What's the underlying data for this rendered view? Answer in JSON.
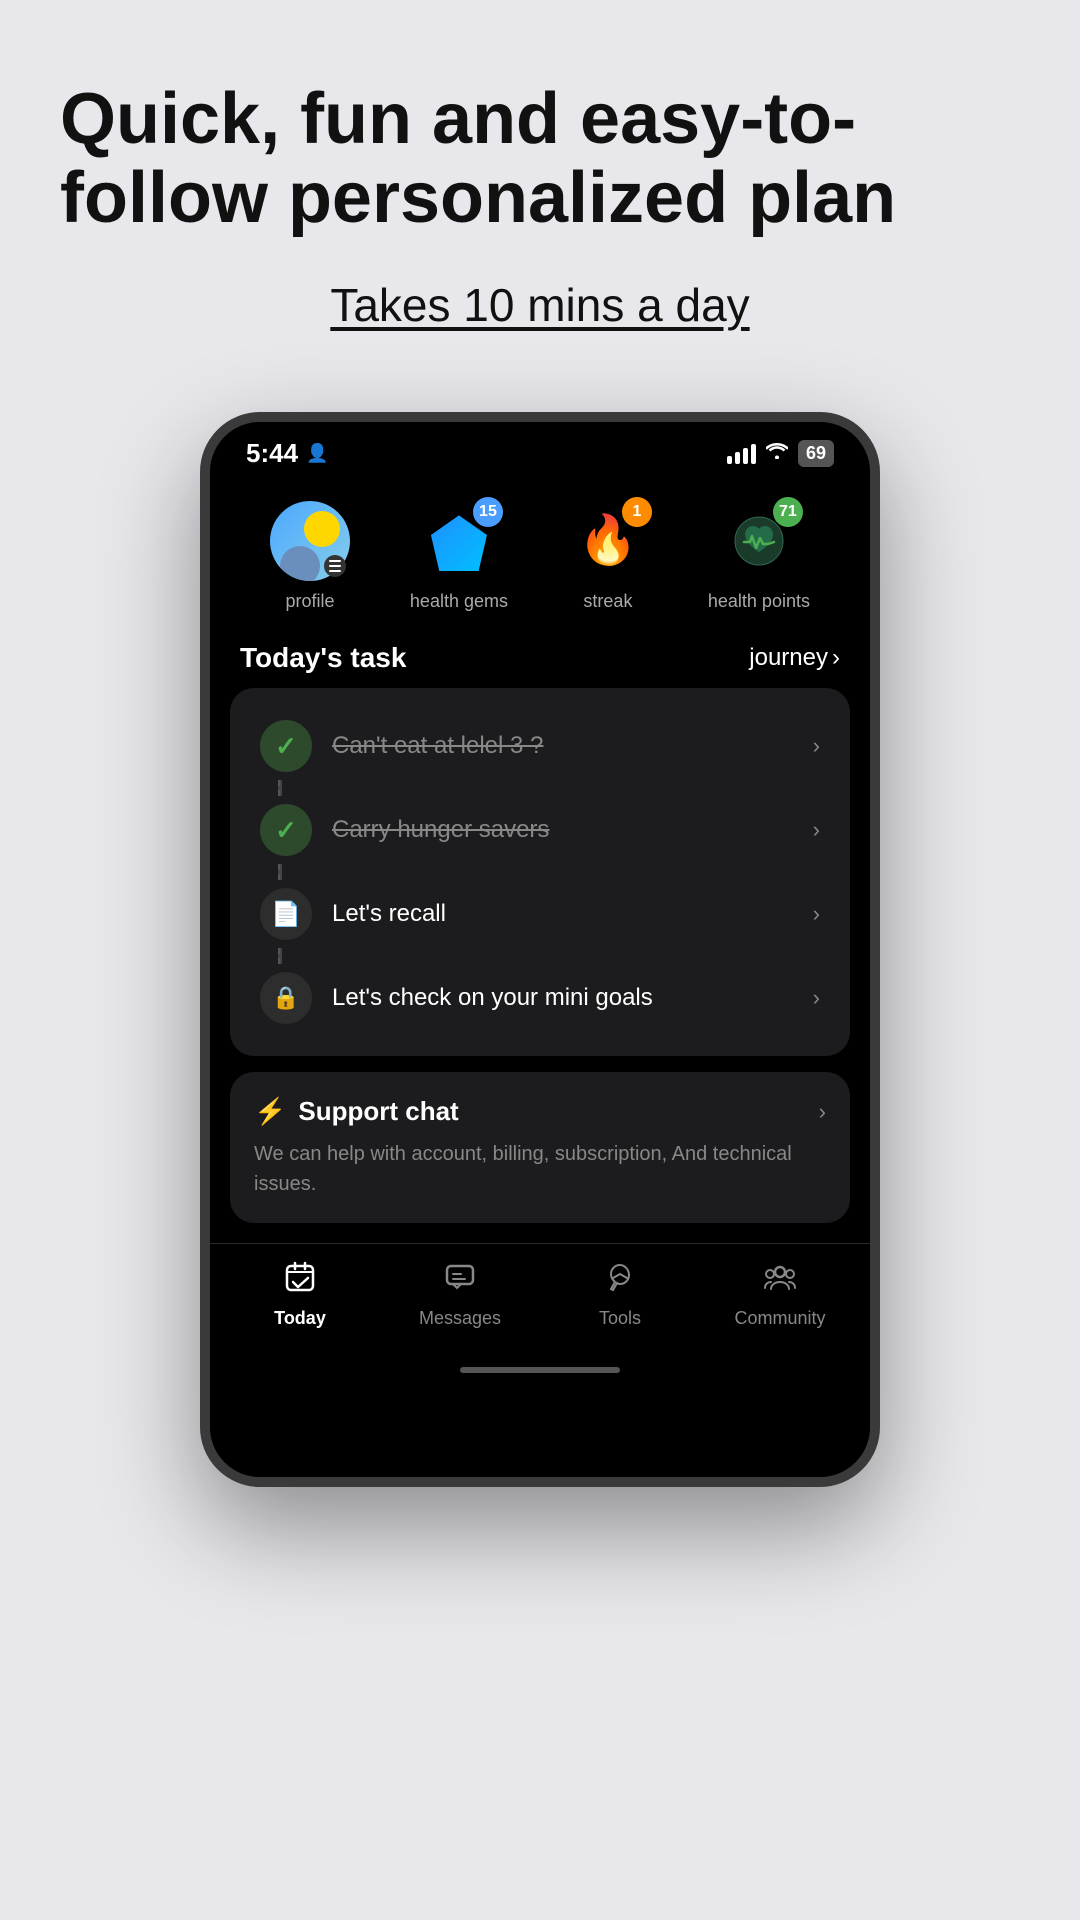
{
  "page": {
    "title": "Quick, fun and easy-to-follow personalized plan",
    "subtitle": "Takes 10 mins a day"
  },
  "statusBar": {
    "time": "5:44",
    "batteryLevel": "69"
  },
  "profileRow": {
    "items": [
      {
        "id": "profile",
        "label": "profile",
        "badge": null
      },
      {
        "id": "health-gems",
        "label": "health gems",
        "badge": "15",
        "badgeColor": "blue"
      },
      {
        "id": "streak",
        "label": "streak",
        "badge": "1",
        "badgeColor": "orange"
      },
      {
        "id": "health-points",
        "label": "health points",
        "badge": "71",
        "badgeColor": "green"
      }
    ]
  },
  "todaySection": {
    "title": "Today's task",
    "link": "journey"
  },
  "tasks": [
    {
      "id": "task-1",
      "text": "Can't eat at lelel 3 ?",
      "completed": true,
      "locked": false
    },
    {
      "id": "task-2",
      "text": "Carry hunger savers",
      "completed": true,
      "locked": false
    },
    {
      "id": "task-3",
      "text": "Let's recall",
      "completed": false,
      "locked": false
    },
    {
      "id": "task-4",
      "text": "Let's check on your mini goals",
      "completed": false,
      "locked": true
    }
  ],
  "supportChat": {
    "title": "Support chat",
    "description": "We can help with account, billing, subscription,\nAnd technical issues."
  },
  "bottomNav": {
    "items": [
      {
        "id": "today",
        "label": "Today",
        "active": true
      },
      {
        "id": "messages",
        "label": "Messages",
        "active": false
      },
      {
        "id": "tools",
        "label": "Tools",
        "active": false
      },
      {
        "id": "community",
        "label": "Community",
        "active": false
      }
    ]
  }
}
